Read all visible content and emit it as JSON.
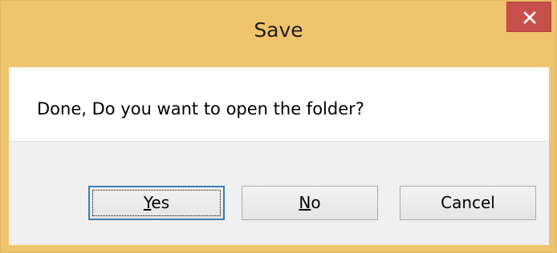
{
  "dialog": {
    "title": "Save",
    "message": "Done, Do you want to open the folder?",
    "close_icon": "close-icon",
    "buttons": {
      "yes": {
        "mnemonic": "Y",
        "rest": "es"
      },
      "no": {
        "mnemonic": "N",
        "rest": "o"
      },
      "cancel": {
        "label": "Cancel"
      }
    }
  },
  "colors": {
    "title_bar": "#f0c46c",
    "close_button": "#c7504b",
    "footer": "#f0f0f0",
    "default_button_border": "#3c7fb1"
  }
}
